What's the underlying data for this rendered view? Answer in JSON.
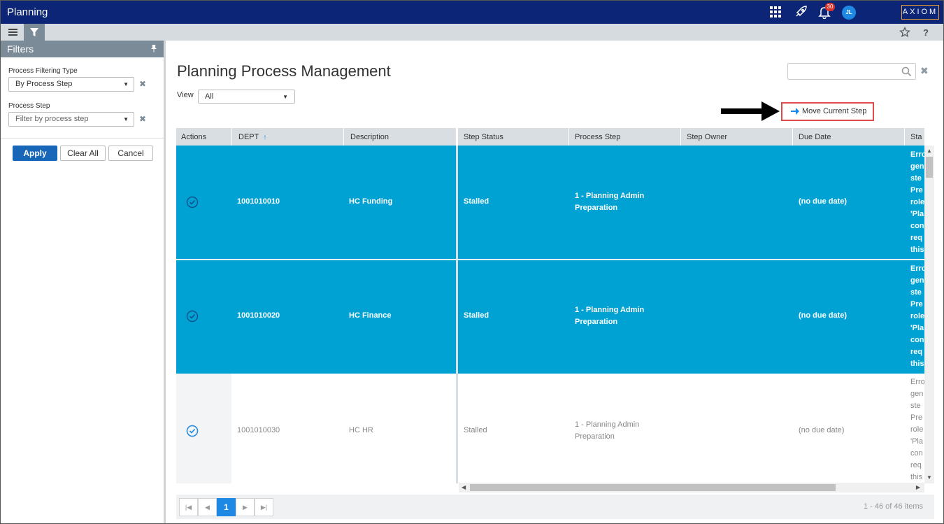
{
  "app": {
    "title": "Planning",
    "notification_count": "30",
    "user_initials": "JL",
    "logo_text": "AXIOM"
  },
  "filters": {
    "title": "Filters",
    "fields": [
      {
        "label": "Process Filtering Type",
        "value": "By Process Step"
      },
      {
        "label": "Process Step",
        "placeholder": "Filter by process step"
      }
    ],
    "apply_label": "Apply",
    "clear_label": "Clear All",
    "cancel_label": "Cancel"
  },
  "main": {
    "title": "Planning Process Management",
    "view_label": "View",
    "view_value": "All",
    "move_button_label": "Move Current Step",
    "columns": [
      "Actions",
      "DEPT",
      "Description",
      "Step Status",
      "Process Step",
      "Step Owner",
      "Due Date",
      "Sta"
    ],
    "rows": [
      {
        "dept": "1001010010",
        "description": "HC Funding",
        "status": "Stalled",
        "step_line1": "1 - Planning Admin",
        "step_line2": "Preparation",
        "due": "(no due date)",
        "selected": true,
        "overflow": [
          "Erro",
          "gen",
          "ste",
          "Pre",
          "role",
          "'Pla",
          "con",
          "req",
          "this"
        ]
      },
      {
        "dept": "1001010020",
        "description": "HC Finance",
        "status": "Stalled",
        "step_line1": "1 - Planning Admin",
        "step_line2": "Preparation",
        "due": "(no due date)",
        "selected": true,
        "overflow": [
          "Erro",
          "gen",
          "ste",
          "Pre",
          "role",
          "'Pla",
          "con",
          "req",
          "this"
        ]
      },
      {
        "dept": "1001010030",
        "description": "HC HR",
        "status": "Stalled",
        "step_line1": "1 - Planning Admin",
        "step_line2": "Preparation",
        "due": "(no due date)",
        "selected": false,
        "overflow": [
          "Erro",
          "gen",
          "ste",
          "Pre",
          "role",
          "'Pla",
          "con",
          "req",
          "this"
        ]
      }
    ],
    "pager": {
      "current_page": "1",
      "info": "1 - 46 of 46 items"
    }
  },
  "colors": {
    "topbar": "#0c2577",
    "selected_row": "#00a2d3",
    "primary_button": "#1766b8",
    "highlight_border": "#e04a4a"
  }
}
